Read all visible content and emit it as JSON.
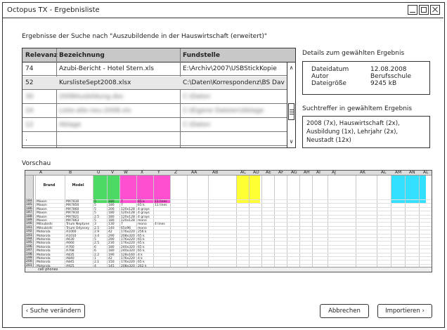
{
  "window": {
    "title": "Octopus TX - Ergebnisliste"
  },
  "heading": "Ergebnisse der Suche nach \"Auszubildende in der Hauswirtschaft (erweitert)\"",
  "results": {
    "columns": [
      "Relevanz",
      "Bezeichnung",
      "Fundstelle"
    ],
    "rows": [
      {
        "relevanz": "74",
        "bezeichnung": "Azubi-Bericht - Hotel Stern.xls",
        "fundstelle": "E:\\Archiv\\2007\\USBStickKopie"
      },
      {
        "relevanz": "52",
        "bezeichnung": "KurslisteSept2008.xlsx",
        "fundstelle": "C:\\Daten\\Korrespondenz\\BS Davidis"
      },
      {
        "relevanz": "30",
        "bezeichnung": "2008Ausbildung.doc",
        "fundstelle": "C:\\Daten"
      },
      {
        "relevanz": "24",
        "bezeichnung": "Liste-alle-neu-2008.xls",
        "fundstelle": "C:\\Eigene Dateien\\Ablage"
      },
      {
        "relevanz": "12",
        "bezeichnung": "Ablage",
        "fundstelle": "C:\\Daten"
      },
      {
        "relevanz": ".",
        "bezeichnung": "",
        "fundstelle": ""
      },
      {
        "relevanz": ".",
        "bezeichnung": "",
        "fundstelle": ""
      }
    ]
  },
  "details": {
    "label": "Details zum gewählten Ergebnis",
    "items": [
      {
        "key": "Dateidatum",
        "value": "12.08.2008"
      },
      {
        "key": "Autor",
        "value": "Berufsschule"
      },
      {
        "key": "Dateigröße",
        "value": "9245 kB"
      }
    ]
  },
  "treffer": {
    "label": "Suchtreffer in gewähltem Ergebnis",
    "text": "2008 (7x), Hauswirtschaft (2x), Ausbildung (1x), Lehrjahr (2x), Neustadt (12x)"
  },
  "preview": {
    "label": "Vorschau",
    "columns": [
      "A",
      "B",
      "U",
      "V",
      "W",
      "X",
      "Y",
      "Z",
      "AA",
      "AB",
      "AC",
      "AD",
      "AE",
      "AF",
      "AG",
      "AH",
      "AI",
      "AJ",
      "AK",
      "AL",
      "AM",
      "AN",
      "AL"
    ],
    "header_brand": "Brand",
    "header_model": "Model",
    "rows": [
      [
        "Maxon",
        "MX7830",
        "5",
        "180",
        "7",
        "65 k",
        "11 lines"
      ],
      [
        "Maxon",
        "MX7850",
        "5",
        "180",
        "7",
        "65 k",
        "11 lines"
      ],
      [
        "Maxon",
        "MX7860",
        "5",
        "200",
        "120x128",
        "4 grays"
      ],
      [
        "Maxon",
        "MX7810",
        "5",
        "180",
        "120x128",
        "4 grays"
      ],
      [
        "Maxon",
        "MX7821",
        "2.5",
        "180",
        "120x128",
        "4 grays"
      ],
      [
        "Maxon",
        "MX7863",
        "5",
        "180",
        "120x128",
        "mono"
      ],
      [
        "Mitsubishi",
        "Trium Neptune",
        "3",
        "130",
        "7",
        "mono",
        "4 lines"
      ],
      [
        "Mitsubishi",
        "Trium Odyssey",
        "2.5",
        "140",
        "65x96",
        "mono"
      ],
      [
        "Motorola",
        "A1000",
        "2.9",
        "42",
        "176x220",
        "256 k"
      ],
      [
        "Motorola",
        "A1010",
        "3.4",
        "290",
        "208x320",
        "65 k"
      ],
      [
        "Motorola",
        "A630",
        "5",
        "290",
        "176x220",
        "65 k"
      ],
      [
        "Motorola",
        "A660",
        "2.5",
        "230",
        "176x220",
        "65 k"
      ],
      [
        "Motorola",
        "A760",
        "6",
        "180",
        "240x320",
        "65 k"
      ],
      [
        "Motorola",
        "A768",
        "6",
        "180",
        "240x320",
        "65 k"
      ],
      [
        "Motorola",
        "A835",
        "2.2",
        "190",
        "128x160",
        "4 k"
      ],
      [
        "Motorola",
        "A840",
        "1",
        "42",
        "176x220",
        "4 k"
      ],
      [
        "Motorola",
        "A845",
        "2.1",
        "150",
        "176x220",
        "65 k"
      ],
      [
        "Motorola",
        "A925",
        "4",
        "145",
        "208x320",
        "262 k"
      ]
    ],
    "sheet_tab": "cell phones"
  },
  "buttons": {
    "back": "‹ Suche verändern",
    "cancel": "Abbrechen",
    "import": "Importieren ›"
  },
  "colors": {
    "green": "#4cd964",
    "magenta": "#ff4fd1",
    "yellow": "#ffff33",
    "cyan": "#33e0ff"
  }
}
